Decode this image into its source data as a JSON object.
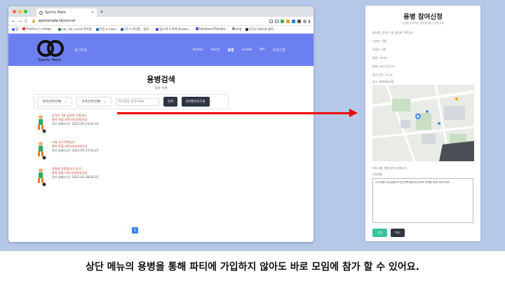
{
  "browser": {
    "tab_title": "Sports Mate",
    "tab_close": "×",
    "new_tab": "+",
    "nav": [
      "←",
      "→",
      "C"
    ],
    "url_host": "sportsmate.tk",
    "url_path": "/recruit",
    "bookmarks": [
      "앱",
      "Practice | codegr...",
      "var, let, const 차이점",
      "한양 e-class",
      "C2-1 코딩통 - 정리...",
      "탐도록 도커에 Docker...",
      "Database/Databa...",
      "png",
      "[Git] Github 블로..."
    ]
  },
  "site": {
    "logo_text": "Sports Mate",
    "nav_left": "로그아웃",
    "nav_items": [
      "Home",
      "Party",
      "용병",
      "Guide",
      "MY",
      "모임신청"
    ],
    "active_nav": "용병"
  },
  "recruit": {
    "title": "용병검색",
    "subtitle": "용병 목록",
    "region_select": "종목선택(전체)",
    "city_select": "지역선택(전체)",
    "search_placeholder": "파티명을 검색하세요",
    "search_button": "검색",
    "register_button": "검색필터초기화",
    "items": [
      {
        "title": "공격수 1명 급하게 구합니다",
        "loc": "종목:풋볼 지역:한양대경기장",
        "date": "경기 날짜/시간: 2022-05-23/14-16"
      },
      {
        "title": "오늘 급구!한테급구",
        "loc": "종목:풋볼 지역:한양대경기장",
        "date": "경기 날짜/시간: 2022-05-27/16-22"
      },
      {
        "title": "용병을 모집합니다 급구!",
        "loc": "종목:풋볼 지역:한양대경기장",
        "date": "경기 날짜/시간: 2022-05-28/18-22"
      }
    ],
    "pages": [
      "‹",
      "1",
      "›"
    ],
    "current_page": "1"
  },
  "form": {
    "title": "용병 참여신청",
    "subtitle": "신청을 입력하여 용병참여를 신청하세요",
    "fields": [
      "파티명: 공격수 1명 급하게 구합니다",
      "스포츠: 풋볼",
      "모집수: 3명",
      "비용: 10000",
      "날짜: 2022-05-23",
      "경기 시간: 14-16",
      "장소: 한양대경기장"
    ],
    "note": "모집 내용: 용병 참여 신청합니다",
    "message_label": "신청내용",
    "message_value": "ex)이름/나이/성별/포지션(선택사항)/간단하게 연락할 위해 적어주세요",
    "submit": "신청",
    "cancel": "취소"
  },
  "caption": "상단 메뉴의 용병을 통해 파티에 가입하지 않아도 바로 모임에 참가 할 수 있어요.",
  "colors": {
    "stage_bg": "#b6c8e8",
    "nav_bg": "#6c7ff1",
    "arrow": "#ee0000",
    "submit_green": "#36c49a",
    "dark_button": "#2f3542"
  }
}
